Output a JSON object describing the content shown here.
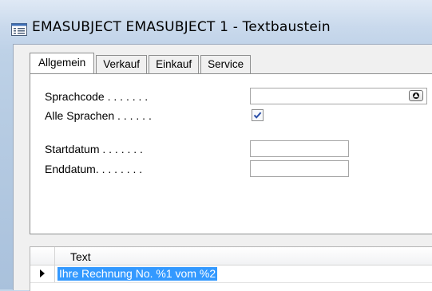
{
  "window": {
    "title": "EMASUBJECT EMASUBJECT 1 - Textbaustein"
  },
  "tabs": [
    {
      "label": "Allgemein",
      "active": true
    },
    {
      "label": "Verkauf",
      "active": false
    },
    {
      "label": "Einkauf",
      "active": false
    },
    {
      "label": "Service",
      "active": false
    }
  ],
  "form": {
    "sprachcode": {
      "label": "Sprachcode . . . . . . .",
      "value": ""
    },
    "alle_sprachen": {
      "label": "Alle Sprachen . . . . . .",
      "checked": true
    },
    "startdatum": {
      "label": "Startdatum . . . . . . .",
      "value": ""
    },
    "enddatum": {
      "label": "Enddatum. . . . . . . .",
      "value": ""
    }
  },
  "grid": {
    "columns": [
      "Text"
    ],
    "rows": [
      {
        "text": "Ihre Rechnung No. %1 vom %2",
        "selected": true
      }
    ]
  },
  "icons": {
    "title": "form-window-icon",
    "lookup": "lookup-arrow-icon",
    "check": "checkmark-icon",
    "row_marker": "current-row-arrow-icon"
  },
  "colors": {
    "selection": "#3399ff",
    "checkmark": "#2b4fa8"
  }
}
